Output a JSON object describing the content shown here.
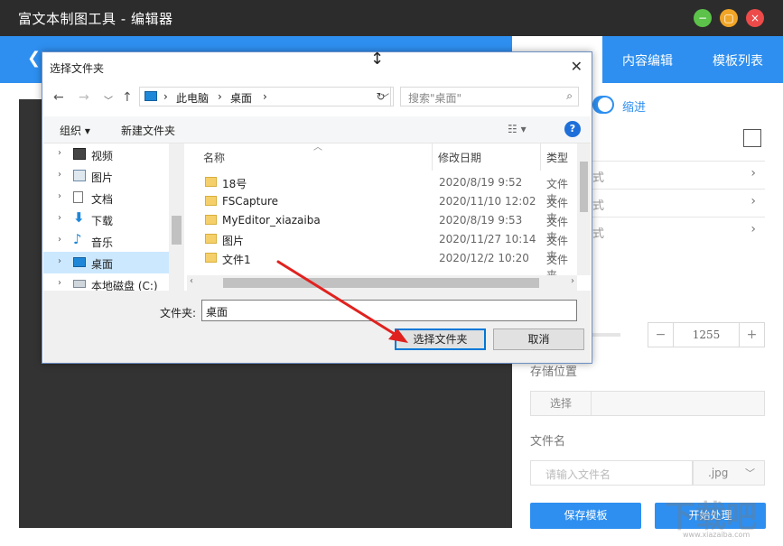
{
  "app": {
    "title": "富文本制图工具 - 编辑器",
    "back_label": "❮",
    "tabs": [
      "内容编辑",
      "模板列表"
    ]
  },
  "right_panel": {
    "indent_label": "缩进",
    "rows": [
      "式",
      "式",
      "式"
    ],
    "stepper_value": "1255",
    "storage_label": "存储位置",
    "choose_label": "选择",
    "filename_label": "文件名",
    "filename_placeholder": "请输入文件名",
    "ext_value": ".jpg",
    "save_template_label": "保存模板",
    "start_label": "开始处理",
    "watermark_url": "www.xiazaiba.com"
  },
  "dialog": {
    "title": "选择文件夹",
    "breadcrumb": [
      "此电脑",
      "桌面"
    ],
    "search_placeholder": "搜索\"桌面\"",
    "toolbar": {
      "organize": "组织 ▾",
      "new_folder": "新建文件夹"
    },
    "tree": [
      {
        "label": "视频",
        "icon": "video-icon",
        "selected": false
      },
      {
        "label": "图片",
        "icon": "picture-icon",
        "selected": false
      },
      {
        "label": "文档",
        "icon": "document-icon",
        "selected": false
      },
      {
        "label": "下载",
        "icon": "download-icon",
        "selected": false
      },
      {
        "label": "音乐",
        "icon": "music-icon",
        "selected": false
      },
      {
        "label": "桌面",
        "icon": "desktop-icon",
        "selected": true
      },
      {
        "label": "本地磁盘 (C:)",
        "icon": "disk-icon",
        "selected": false
      }
    ],
    "columns": [
      "名称",
      "修改日期",
      "类型"
    ],
    "files": [
      {
        "name": "18号",
        "date": "2020/8/19 9:52",
        "type": "文件夹"
      },
      {
        "name": "FSCapture",
        "date": "2020/11/10 12:02",
        "type": "文件夹"
      },
      {
        "name": "MyEditor_xiazaiba",
        "date": "2020/8/19 9:53",
        "type": "文件夹"
      },
      {
        "name": "图片",
        "date": "2020/11/27 10:14",
        "type": "文件夹"
      },
      {
        "name": "文件1",
        "date": "2020/12/2 10:20",
        "type": "文件夹"
      }
    ],
    "folder_label": "文件夹:",
    "folder_value": "桌面",
    "ok_label": "选择文件夹",
    "cancel_label": "取消"
  }
}
